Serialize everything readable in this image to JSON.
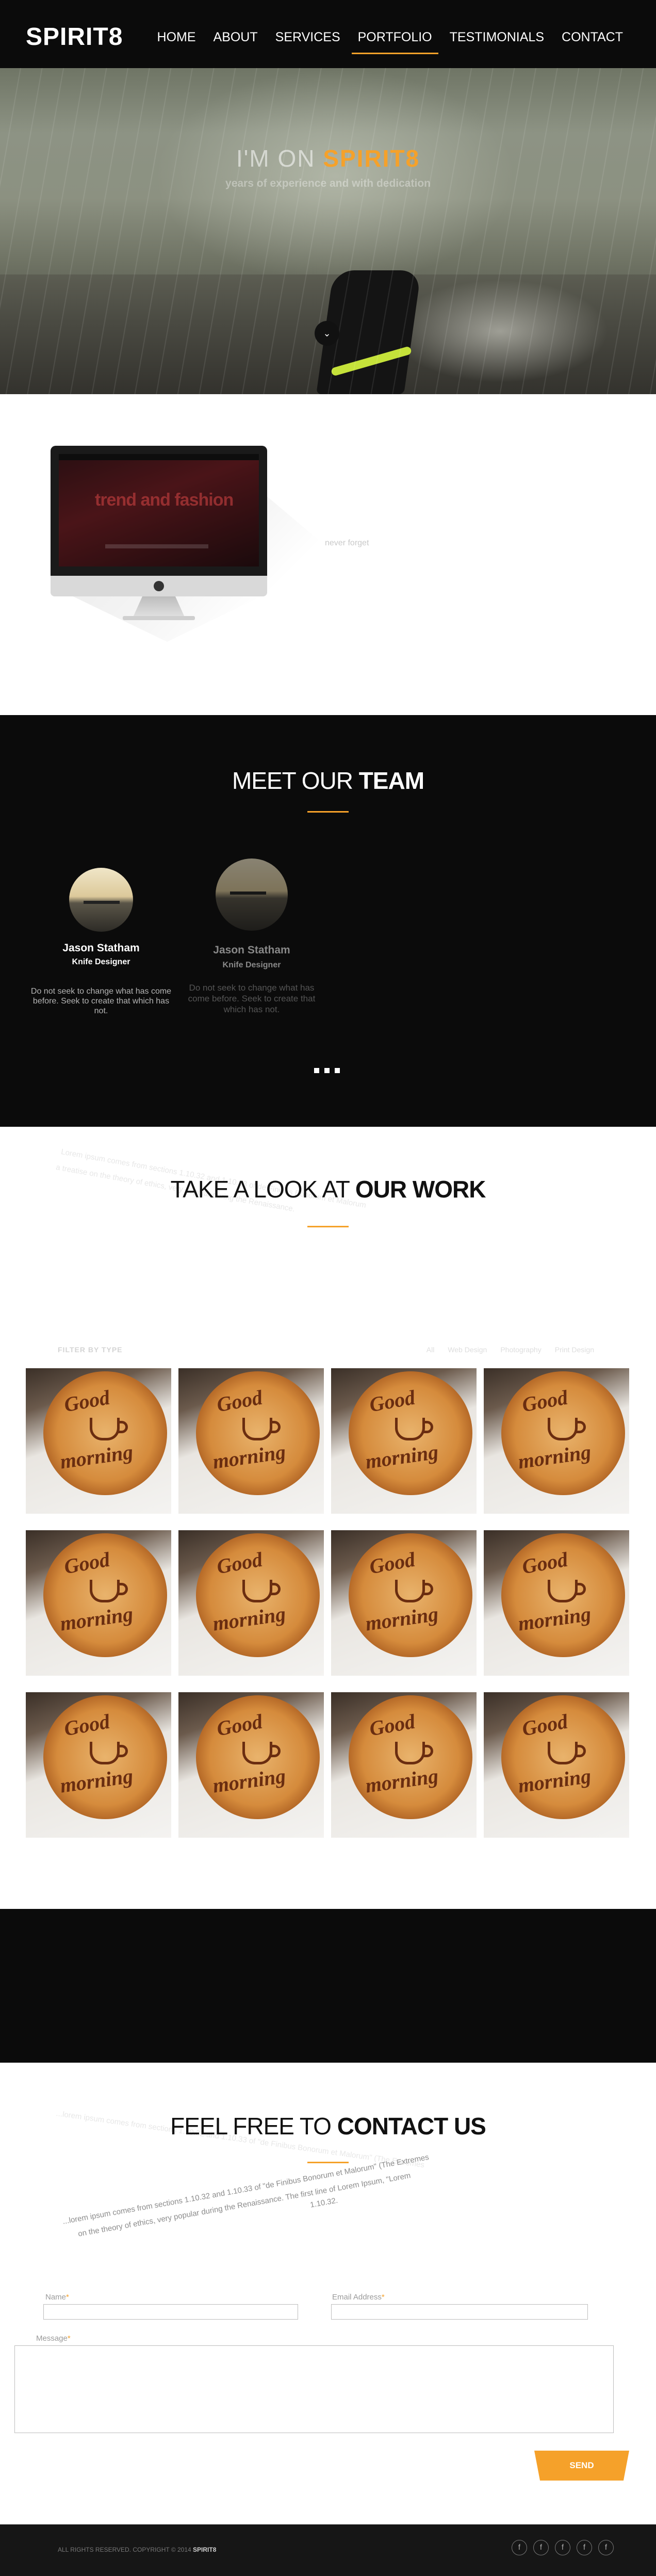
{
  "brand": {
    "logo": "SPIRIT8",
    "accent_color": "#f5a12a"
  },
  "nav": {
    "items": [
      {
        "label": "HOME"
      },
      {
        "label": "ABOUT"
      },
      {
        "label": "SERVICES"
      },
      {
        "label": "PORTFOLIO"
      },
      {
        "label": "TESTIMONIALS"
      },
      {
        "label": "CONTACT"
      }
    ],
    "active": "PORTFOLIO"
  },
  "hero": {
    "title_prefix": "I'M ON",
    "title_highlight": "SPIRIT8",
    "subtitle": "years of experience and with dedication",
    "scroll_icon": "chevron-down-icon"
  },
  "about": {
    "screen_text": "trend and fashion",
    "side_text": "never forget"
  },
  "team": {
    "title_plain": "MEET OUR",
    "title_bold": "TEAM",
    "members": [
      {
        "name": "Jason Statham",
        "role": "Knife Designer",
        "bio": "Do not seek to change what has come before. Seek to create that which has not."
      },
      {
        "name": "Jason Statham",
        "role": "Knife Designer",
        "bio": "Do not seek to change what has come before. Seek to create that which has not."
      }
    ]
  },
  "work": {
    "title_plain": "TAKE A LOOK AT",
    "title_bold": "OUR WORK",
    "faint_lines": [
      "Lorem ipsum comes from sections 1.10.32 and 1.10.33 of de Finibus Bonorum et Malorum",
      "a treatise on the theory of ethics, very popular during the Renaissance."
    ],
    "filter_label": "FILTER BY TYPE",
    "filters": [
      "All",
      "Web Design",
      "Photography",
      "Print Design"
    ],
    "tiles": [
      {
        "text_top": "Good",
        "text_bottom": "morning"
      },
      {
        "text_top": "Good",
        "text_bottom": "morning"
      },
      {
        "text_top": "Good",
        "text_bottom": "morning"
      },
      {
        "text_top": "Good",
        "text_bottom": "morning"
      },
      {
        "text_top": "Good",
        "text_bottom": "morning"
      },
      {
        "text_top": "Good",
        "text_bottom": "morning"
      },
      {
        "text_top": "Good",
        "text_bottom": "morning"
      },
      {
        "text_top": "Good",
        "text_bottom": "morning"
      },
      {
        "text_top": "Good",
        "text_bottom": "morning"
      },
      {
        "text_top": "Good",
        "text_bottom": "morning"
      },
      {
        "text_top": "Good",
        "text_bottom": "morning"
      },
      {
        "text_top": "Good",
        "text_bottom": "morning"
      }
    ]
  },
  "contact": {
    "title_plain": "FEEL FREE TO",
    "title_bold": "CONTACT US",
    "faint_lines": [
      "...lorem ipsum comes from sections 1.10.32 and 1.10.33 of \"de Finibus Bonorum et Malorum\" (The Extremes",
      "on the theory of ethics, very popular during the Renaissance. The first line of Lorem Ipsum, \"Lorem",
      "1.10.32."
    ],
    "name_label": "Name",
    "email_label": "Email Address",
    "message_label": "Message",
    "required_mark": "*",
    "send_label": "SEND"
  },
  "footer": {
    "copyright_prefix": "ALL RIGHTS RESERVED. COPYRIGHT © 2014",
    "copyright_brand": "SPIRIT8",
    "social_glyph": "f",
    "social_icons": [
      "facebook-icon",
      "facebook-icon",
      "facebook-icon",
      "facebook-icon",
      "facebook-icon"
    ]
  }
}
